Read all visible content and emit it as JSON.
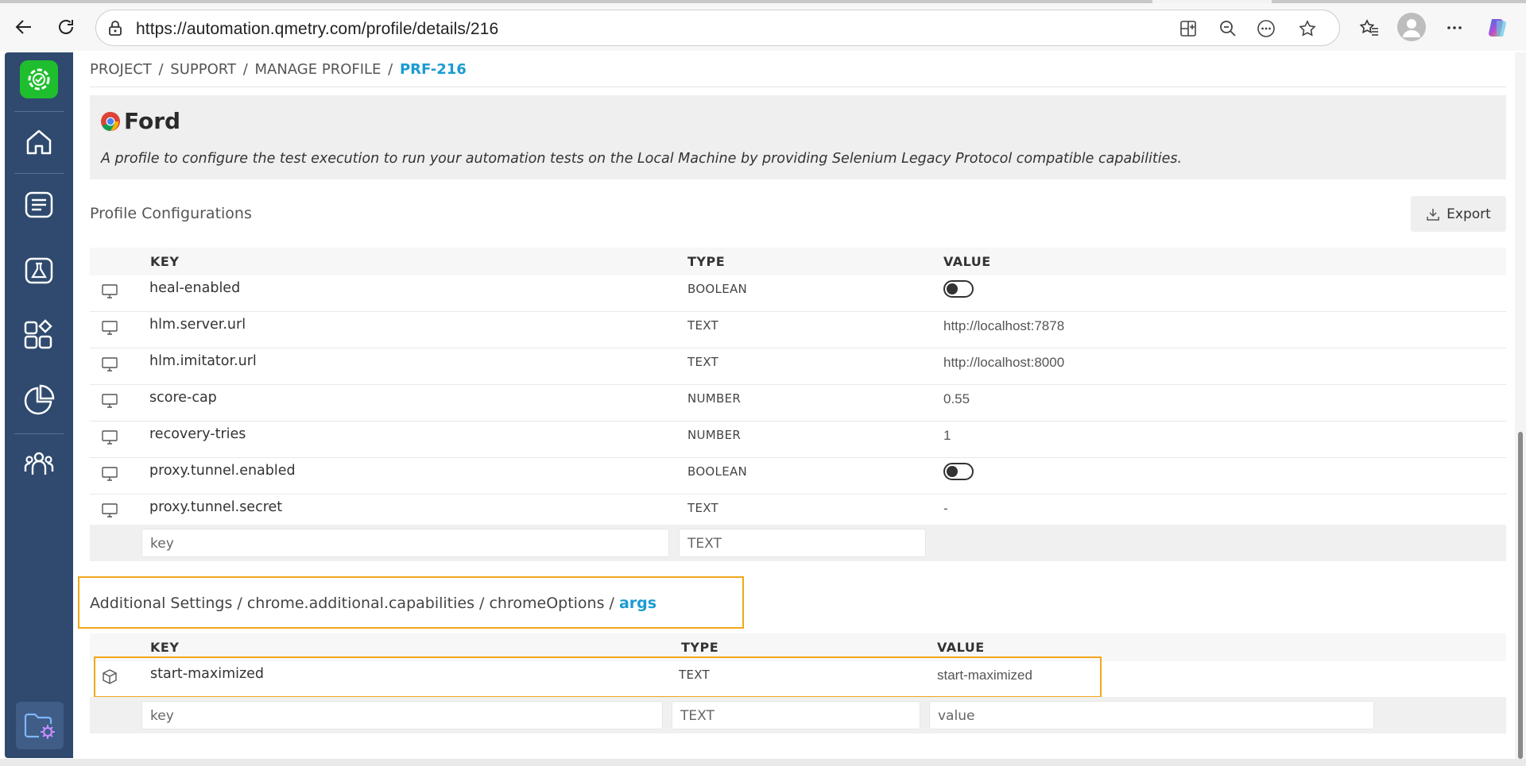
{
  "browser": {
    "url": "https://automation.qmetry.com/profile/details/216"
  },
  "breadcrumb": {
    "items": [
      "PROJECT",
      "SUPPORT",
      "MANAGE PROFILE"
    ],
    "current": "PRF-216"
  },
  "profile": {
    "name": "Ford",
    "description": "A profile to configure the test execution to run your automation tests on the Local Machine by providing Selenium Legacy Protocol compatible capabilities."
  },
  "config": {
    "title": "Profile Configurations",
    "export_label": "Export",
    "headers": {
      "key": "KEY",
      "type": "TYPE",
      "value": "VALUE"
    },
    "rows": [
      {
        "key": "heal-enabled",
        "type": "BOOLEAN",
        "value": "",
        "toggle": true
      },
      {
        "key": "hlm.server.url",
        "type": "TEXT",
        "value": "http://localhost:7878"
      },
      {
        "key": "hlm.imitator.url",
        "type": "TEXT",
        "value": "http://localhost:8000"
      },
      {
        "key": "score-cap",
        "type": "NUMBER",
        "value": "0.55"
      },
      {
        "key": "recovery-tries",
        "type": "NUMBER",
        "value": "1"
      },
      {
        "key": "proxy.tunnel.enabled",
        "type": "BOOLEAN",
        "value": "",
        "toggle": true
      },
      {
        "key": "proxy.tunnel.secret",
        "type": "TEXT",
        "value": "-"
      }
    ],
    "new_row": {
      "key_placeholder": "key",
      "type": "TEXT"
    }
  },
  "additional": {
    "crumbs": [
      "Additional Settings",
      "chrome.additional.capabilities",
      "chromeOptions"
    ],
    "current": "args",
    "headers": {
      "key": "KEY",
      "type": "TYPE",
      "value": "VALUE"
    },
    "rows": [
      {
        "key": "start-maximized",
        "type": "TEXT",
        "value": "start-maximized"
      }
    ],
    "new_row": {
      "key_placeholder": "key",
      "type": "TEXT",
      "value_placeholder": "value"
    }
  },
  "colors": {
    "sidebar": "#2f4a6e",
    "accent": "#1b9bd1",
    "highlight": "#f1a81b",
    "logo": "#1fbe2e"
  }
}
